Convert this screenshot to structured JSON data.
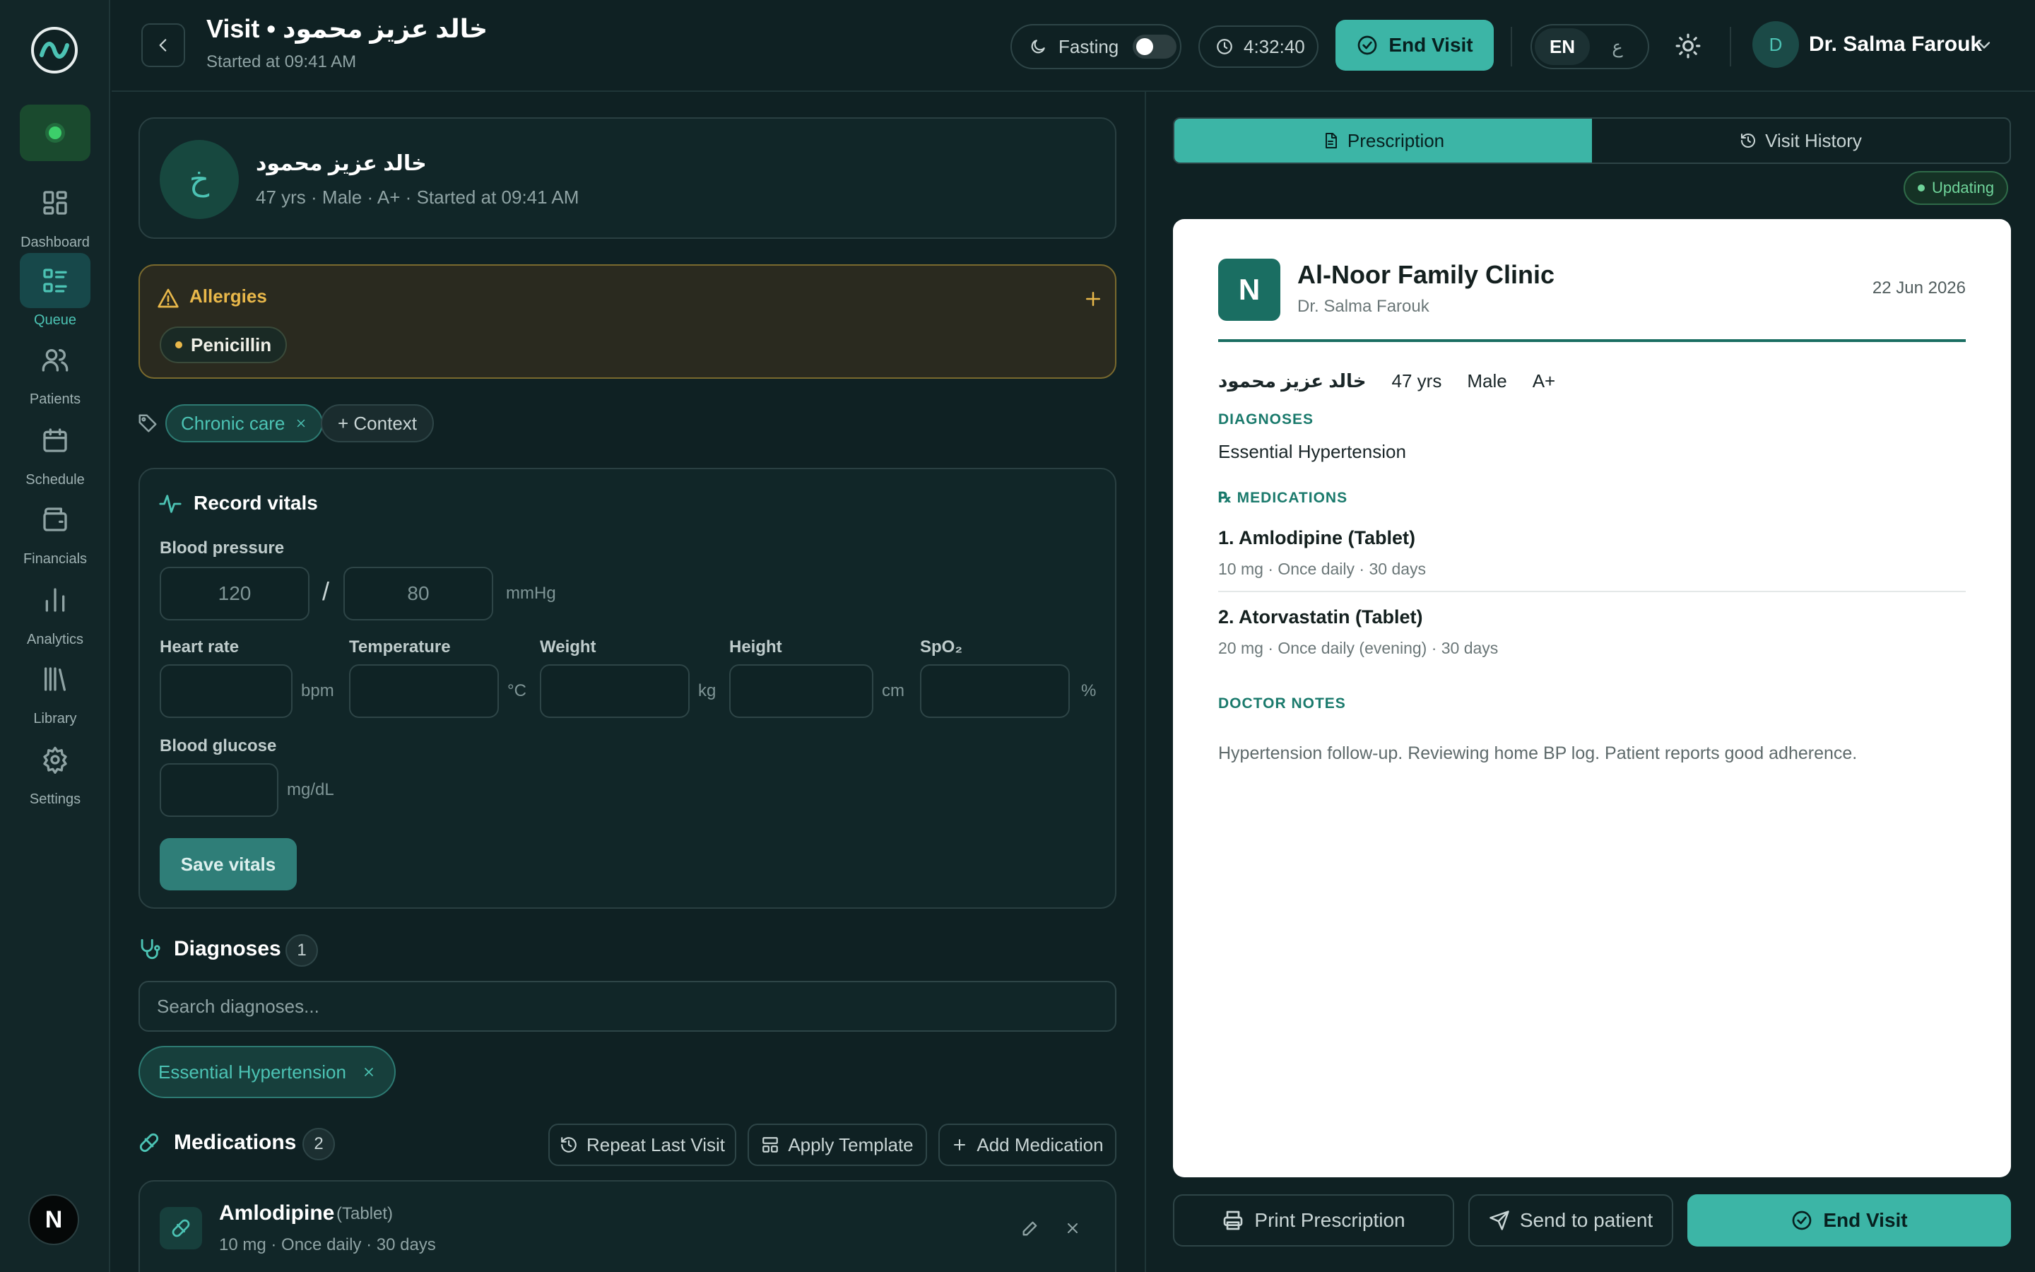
{
  "sidebar": {
    "items": [
      {
        "label": "Dashboard",
        "icon": "grid-icon"
      },
      {
        "label": "Queue",
        "icon": "list-icon"
      },
      {
        "label": "Patients",
        "icon": "users-icon"
      },
      {
        "label": "Schedule",
        "icon": "calendar-icon"
      },
      {
        "label": "Financials",
        "icon": "wallet-icon"
      },
      {
        "label": "Analytics",
        "icon": "bar-chart-icon"
      },
      {
        "label": "Library",
        "icon": "library-icon"
      },
      {
        "label": "Settings",
        "icon": "gear-icon"
      }
    ],
    "active": "Queue",
    "bottom_avatar": "N"
  },
  "header": {
    "title": "Visit • خالد عزيز محمود",
    "subtitle": "Started at 09:41 AM",
    "fasting_label": "Fasting",
    "fasting_on": false,
    "timer": "4:32:40",
    "end_visit_label": "End Visit",
    "lang_en": "EN",
    "lang_ar": "ع",
    "user_initial": "D",
    "user_name": "Dr. Salma Farouk"
  },
  "patient": {
    "initial": "خ",
    "name": "خالد عزيز محمود",
    "meta": "47 yrs · Male · A+ · Started at 09:41 AM"
  },
  "allergies": {
    "title": "Allergies",
    "items": [
      "Penicillin"
    ]
  },
  "context": {
    "tags": [
      "Chronic care"
    ],
    "add_label": "+ Context"
  },
  "vitals": {
    "title": "Record vitals",
    "bp_label": "Blood pressure",
    "bp_systolic_placeholder": "120",
    "bp_diastolic_placeholder": "80",
    "bp_unit": "mmHg",
    "heart_rate_label": "Heart rate",
    "heart_rate_unit": "bpm",
    "temperature_label": "Temperature",
    "temperature_unit": "°C",
    "weight_label": "Weight",
    "weight_unit": "kg",
    "height_label": "Height",
    "height_unit": "cm",
    "spo2_label": "SpO₂",
    "spo2_unit": "%",
    "glucose_label": "Blood glucose",
    "glucose_unit": "mg/dL",
    "save_label": "Save vitals"
  },
  "diagnoses": {
    "title": "Diagnoses",
    "count": "1",
    "search_placeholder": "Search diagnoses...",
    "items": [
      "Essential Hypertension"
    ]
  },
  "medications": {
    "title": "Medications",
    "count": "2",
    "repeat_label": "Repeat Last Visit",
    "template_label": "Apply Template",
    "add_label": "Add Medication",
    "items": [
      {
        "name": "Amlodipine",
        "form": "(Tablet)",
        "dose": "10 mg · Once daily · 30 days"
      }
    ]
  },
  "right_panel": {
    "tab_prescription": "Prescription",
    "tab_history": "Visit History",
    "status": "Updating",
    "clinic_initial": "N",
    "clinic_name": "Al-Noor Family Clinic",
    "doctor": "Dr. Salma Farouk",
    "date": "22 Jun 2026",
    "patient_name": "خالد عزيز محمود",
    "patient_age": "47 yrs",
    "patient_sex": "Male",
    "patient_blood": "A+",
    "diagnoses_heading": "DIAGNOSES",
    "diagnosis_text": "Essential Hypertension",
    "medications_heading": "℞ MEDICATIONS",
    "meds": [
      {
        "title": "1. Amlodipine (Tablet)",
        "dose": "10 mg · Once daily · 30 days"
      },
      {
        "title": "2. Atorvastatin (Tablet)",
        "dose": "20 mg · Once daily (evening) · 30 days"
      }
    ],
    "notes_heading": "DOCTOR NOTES",
    "notes_text": "Hypertension follow-up. Reviewing home BP log. Patient reports good adherence.",
    "print_label": "Print Prescription",
    "send_label": "Send to patient",
    "end_label": "End Visit"
  },
  "colors": {
    "accent": "#3cb5a6",
    "background": "#0f2123",
    "allergy": "#e9b84a",
    "status_ok": "#3ccf6a"
  }
}
